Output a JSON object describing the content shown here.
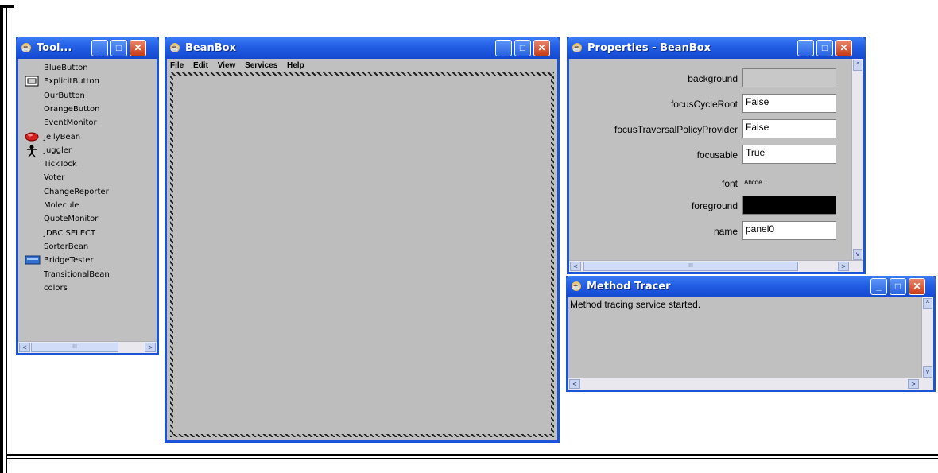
{
  "toolbox": {
    "title": "Tool...",
    "items": [
      {
        "label": "BlueButton",
        "icon": ""
      },
      {
        "label": "ExplicitButton",
        "icon": "button-icon"
      },
      {
        "label": "OurButton",
        "icon": ""
      },
      {
        "label": "OrangeButton",
        "icon": ""
      },
      {
        "label": "EventMonitor",
        "icon": ""
      },
      {
        "label": "JellyBean",
        "icon": "jellybean-icon"
      },
      {
        "label": "Juggler",
        "icon": "juggler-icon"
      },
      {
        "label": "TickTock",
        "icon": ""
      },
      {
        "label": "Voter",
        "icon": ""
      },
      {
        "label": "ChangeReporter",
        "icon": ""
      },
      {
        "label": "Molecule",
        "icon": ""
      },
      {
        "label": "QuoteMonitor",
        "icon": ""
      },
      {
        "label": "JDBC SELECT",
        "icon": ""
      },
      {
        "label": "SorterBean",
        "icon": ""
      },
      {
        "label": "BridgeTester",
        "icon": "bridge-icon"
      },
      {
        "label": "TransitionalBean",
        "icon": ""
      },
      {
        "label": "colors",
        "icon": ""
      }
    ],
    "scroll_left": "<",
    "scroll_right": ">",
    "scroll_thumb": "III"
  },
  "beanbox": {
    "title": "BeanBox",
    "menu": [
      "File",
      "Edit",
      "View",
      "Services",
      "Help"
    ]
  },
  "properties": {
    "title": "Properties - BeanBox",
    "rows": [
      {
        "label": "background",
        "value": "",
        "kind": "color-gray"
      },
      {
        "label": "focusCycleRoot",
        "value": "False",
        "kind": "text"
      },
      {
        "label": "focusTraversalPolicyProvider",
        "value": "False",
        "kind": "text"
      },
      {
        "label": "focusable",
        "value": "True",
        "kind": "text"
      },
      {
        "label": "font",
        "value": "Abcde...",
        "kind": "font"
      },
      {
        "label": "foreground",
        "value": "",
        "kind": "color-black"
      },
      {
        "label": "name",
        "value": "panel0",
        "kind": "text"
      }
    ],
    "scroll_thumb": "III"
  },
  "tracer": {
    "title": "Method Tracer",
    "text": "Method tracing service started."
  },
  "window_buttons": {
    "minimize": "_",
    "maximize": "□",
    "close": "✕"
  },
  "colors": {
    "titlebar": "#2460e6",
    "window_bg": "#c0c0c0",
    "close_button": "#c83c18"
  }
}
